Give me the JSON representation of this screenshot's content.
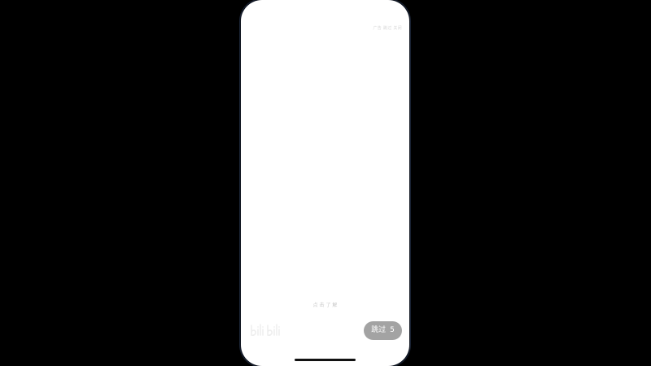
{
  "splash": {
    "ad_label": "广告 跳过 关闭",
    "hint": "点 击 了 解",
    "logo_icon": "bilibili-logo-icon",
    "skip": {
      "label": "跳过",
      "countdown": "5"
    }
  },
  "colors": {
    "background": "#000000",
    "screen": "#ffffff",
    "skip_button": "#a3a3a3"
  }
}
